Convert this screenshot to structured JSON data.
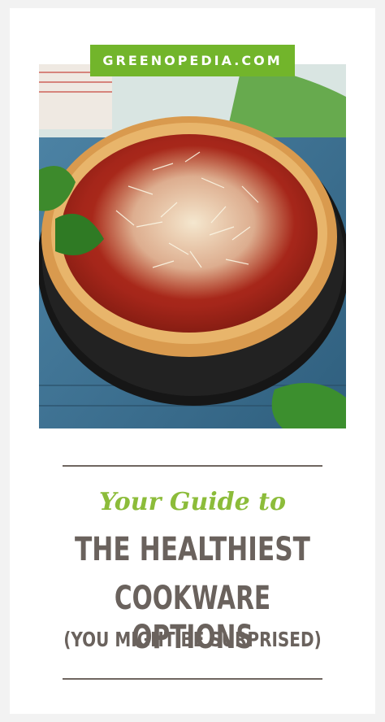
{
  "brand": {
    "label": "GREENOPEDIA.COM",
    "color": "#72b52b"
  },
  "hero": {
    "alt": "Deep dish pizza with tomato sauce and grated cheese in a black baking dish with basil leaves"
  },
  "text": {
    "subtitle": "Your Guide to",
    "headline_line1": "THE HEALTHIEST",
    "headline_line2": "COOKWARE OPTIONS",
    "headline_line3": "(YOU MIGHT BE SURPRISED)"
  },
  "colors": {
    "subtitle": "#8cbc3a",
    "headline": "#6a625d",
    "rule": "#6f6660"
  }
}
